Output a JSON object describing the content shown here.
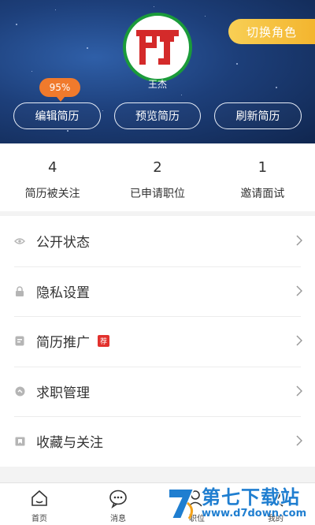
{
  "header": {
    "switch_role_label": "切换角色",
    "user_name": "王杰",
    "completion_badge": "95%",
    "buttons": {
      "edit": "编辑简历",
      "preview": "预览简历",
      "refresh": "刷新简历"
    }
  },
  "stats": [
    {
      "value": "4",
      "label": "简历被关注"
    },
    {
      "value": "2",
      "label": "已申请职位"
    },
    {
      "value": "1",
      "label": "邀请面试"
    }
  ],
  "menu": [
    {
      "label": "公开状态",
      "icon": "eye-icon"
    },
    {
      "label": "隐私设置",
      "icon": "lock-icon"
    },
    {
      "label": "简历推广",
      "icon": "resume-promote-icon",
      "tag": "荐"
    },
    {
      "label": "求职管理",
      "icon": "job-manage-icon"
    },
    {
      "label": "收藏与关注",
      "icon": "favorite-icon"
    }
  ],
  "tabbar": [
    {
      "label": "首页",
      "icon": "home-icon"
    },
    {
      "label": "消息",
      "icon": "message-icon"
    },
    {
      "label": "职位",
      "icon": "position-icon"
    },
    {
      "label": "我的",
      "icon": "profile-icon"
    }
  ],
  "watermark": {
    "title": "第七下载站",
    "url": "www.d7down.com"
  },
  "colors": {
    "header_bg": "#1d3f7a",
    "accent_yellow": "#f3b52f",
    "badge_orange": "#f07a2c",
    "avatar_border": "#1a9b3a",
    "logo_red": "#d42a2a",
    "tag_red": "#e2312d",
    "watermark_blue": "#1f7ed0"
  }
}
